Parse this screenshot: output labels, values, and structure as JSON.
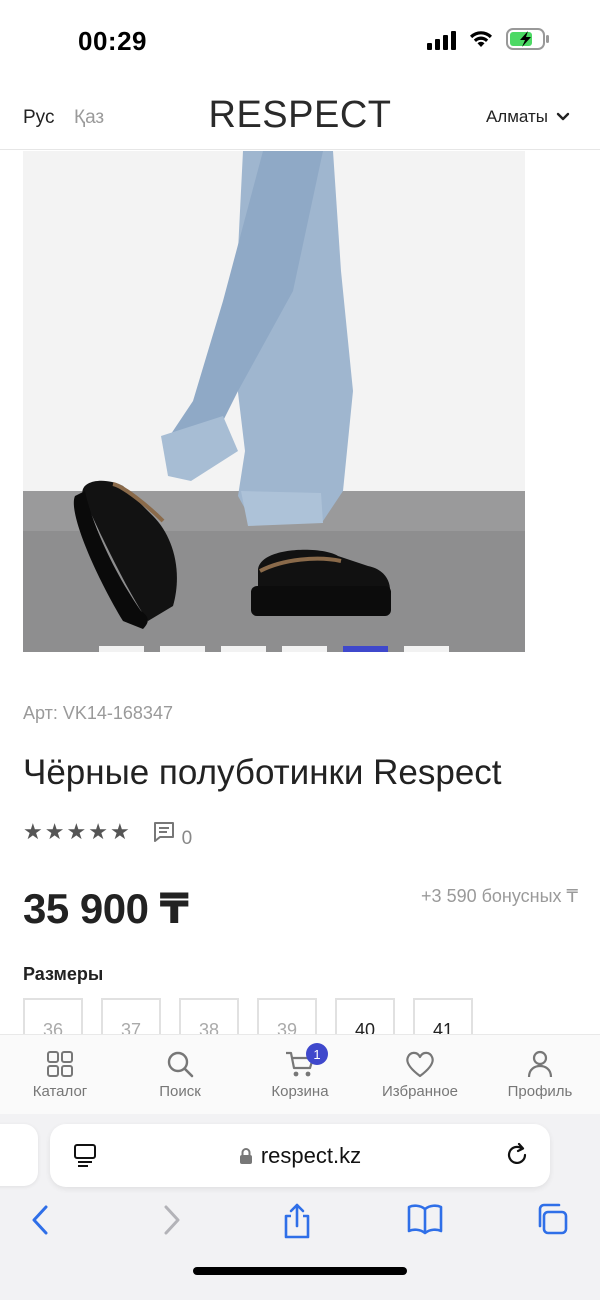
{
  "status_bar": {
    "time": "00:29",
    "icons": [
      "signal-icon",
      "wifi-icon",
      "battery-charging-icon"
    ]
  },
  "header": {
    "lang_ru": "Рус",
    "lang_kz": "Қаз",
    "logo": "RESPECT",
    "city": "Алматы"
  },
  "product": {
    "article": "Арт: VK14-168347",
    "title": "Чёрные полуботинки Respect",
    "rating_stars": 5,
    "reviews_count": "0",
    "price": "35 900 ₸",
    "bonus": "+3 590 бонусных ₸",
    "carousel_total": 6,
    "carousel_active_index": 4
  },
  "sizes": {
    "label": "Размеры",
    "items": [
      {
        "value": "36",
        "available": false
      },
      {
        "value": "37",
        "available": false
      },
      {
        "value": "38",
        "available": false
      },
      {
        "value": "39",
        "available": false
      },
      {
        "value": "40",
        "available": true
      },
      {
        "value": "41",
        "available": true
      }
    ]
  },
  "tab_bar": {
    "catalog": "Каталог",
    "search": "Поиск",
    "cart": "Корзина",
    "cart_badge": "1",
    "favorites": "Избранное",
    "profile": "Профиль"
  },
  "browser": {
    "url": "respect.kz"
  },
  "colors": {
    "accent": "#3f48cc",
    "muted_text": "#9a9a9a",
    "text": "#222222"
  }
}
